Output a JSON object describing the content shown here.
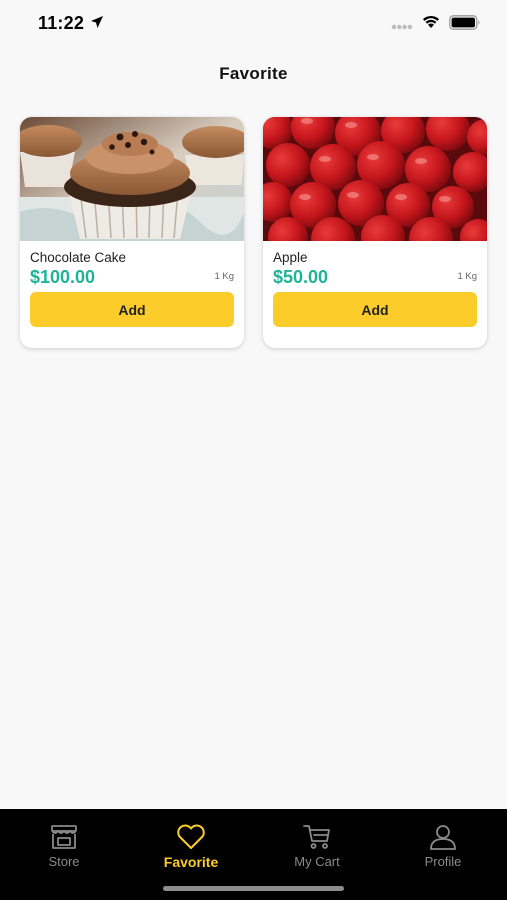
{
  "status_bar": {
    "time": "11:22"
  },
  "header": {
    "title": "Favorite"
  },
  "products": [
    {
      "name": "Chocolate Cake",
      "price": "$100.00",
      "unit": "1 Kg",
      "add_label": "Add",
      "image_icon": "cupcake-image"
    },
    {
      "name": "Apple",
      "price": "$50.00",
      "unit": "1 Kg",
      "add_label": "Add",
      "image_icon": "apples-image"
    }
  ],
  "tabs": [
    {
      "label": "Store",
      "icon": "store-icon",
      "active": false
    },
    {
      "label": "Favorite",
      "icon": "heart-icon",
      "active": true
    },
    {
      "label": "My Cart",
      "icon": "cart-icon",
      "active": false
    },
    {
      "label": "Profile",
      "icon": "profile-icon",
      "active": false
    }
  ],
  "colors": {
    "accent": "#fccd2a",
    "price": "#1fb497",
    "tab_bar": "#000000",
    "background": "#f8f8f9"
  }
}
